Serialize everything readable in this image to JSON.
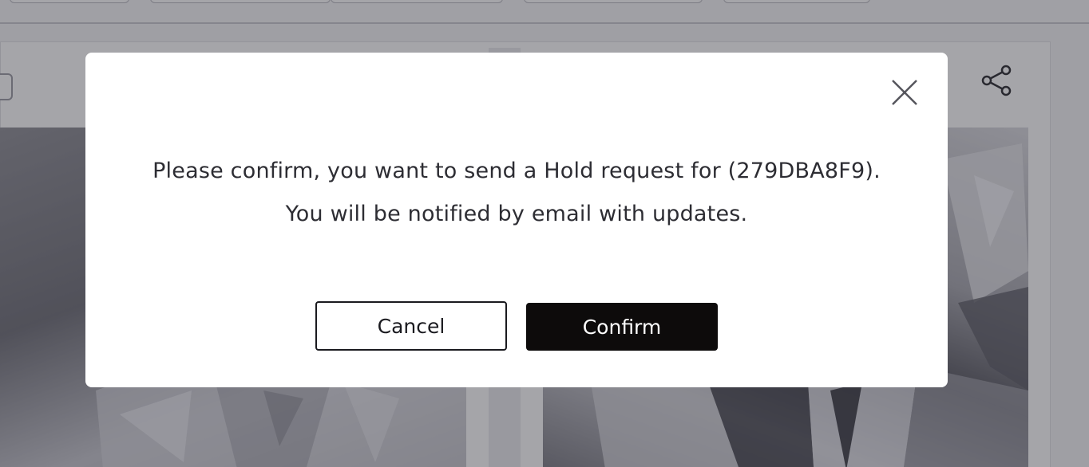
{
  "dialog": {
    "message_line1": "Please confirm, you want to send a Hold request for (279DBA8F9).",
    "message_line2": "You will be notified by email with updates.",
    "cancel_label": "Cancel",
    "confirm_label": "Confirm",
    "close_icon": "close-icon"
  },
  "background": {
    "share_icon": "share-icon",
    "overlay_color": "#28283280"
  },
  "colors": {
    "confirm_bg": "#0d0b0b",
    "confirm_text": "#ffffff",
    "cancel_border": "#1a1a1f",
    "text": "#2d2d33"
  }
}
